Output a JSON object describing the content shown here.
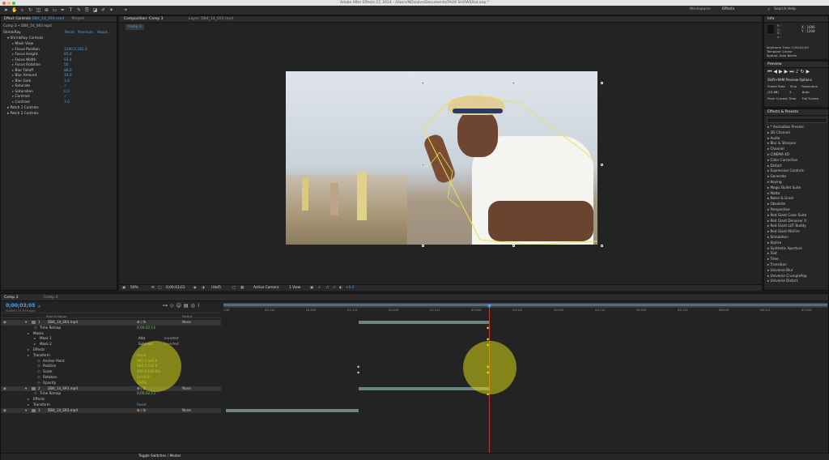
{
  "app": {
    "title": "Adobe After Effects CC 2014 - /Users/NDisalvo/Documents/FAUX SHOWS/tut.aep *",
    "workspace_label": "Workspace:",
    "workspace_value": "Effects",
    "search_placeholder": "Search Help"
  },
  "effect_controls": {
    "tab_label": "Effect Controls",
    "tab_file": "DB4_14_S93.mp4",
    "project_tab": "Project",
    "breadcrumb": "Comp 3 • DB4_14_S93.mp4",
    "effect_name": "ShrinkRay",
    "links": [
      "Reset",
      "Premium",
      "About..."
    ],
    "group": "ShrinkRay Controls",
    "params": [
      {
        "name": "Mask View",
        "value": ""
      },
      {
        "name": "Focus Position",
        "value": "1200.0,282.0"
      },
      {
        "name": "Focus Height",
        "value": "95.0"
      },
      {
        "name": "Focus Width",
        "value": "93.4"
      },
      {
        "name": "Focus Rotation",
        "value": "50"
      },
      {
        "name": "Blur Falloff",
        "value": "88.0"
      },
      {
        "name": "Blur Amount",
        "value": "14.0"
      },
      {
        "name": "Blur Gain",
        "value": "1.0"
      },
      {
        "name": "Saturate",
        "value": "✓"
      },
      {
        "name": "Saturation",
        "value": "0.0"
      },
      {
        "name": "Contrast",
        "value": "✓"
      },
      {
        "name": "Contrast",
        "value": "3.0"
      }
    ],
    "extra": [
      "Patch 1 Controls",
      "Patch 2 Controls"
    ]
  },
  "composition": {
    "tab_label": "Composition: Comp 3",
    "layer_tab": "Layer: DB4_14_S93.mp4",
    "sub_tab": "Comp 3",
    "zoom": "50%",
    "timecode": "0;00;03;01",
    "resolution": "(Half)",
    "camera": "Active Camera",
    "view": "1 View",
    "exposure": "+0.0"
  },
  "info": {
    "tab": "Info",
    "r": "R :",
    "g": "G :",
    "b": "B :",
    "a": "A :",
    "x": "X : 1696",
    "y": "Y : 1208",
    "keyframe_time": "Keyframe Time: 0;00;02;00",
    "temporal": "Temporal: Linear",
    "spatial": "Spatial: Auto Bezier"
  },
  "preview": {
    "tab": "Preview",
    "options": "Shift+RAM Preview Options",
    "frame_rate_label": "Frame Rate",
    "skip_label": "Skip",
    "resolution_label": "Resolution",
    "frame_rate": "(23.98)",
    "skip": "2",
    "resolution": "Auto",
    "from_current": "From Current Time",
    "full_screen": "Full Screen"
  },
  "effects_presets": {
    "tab": "Effects & Presets",
    "items": [
      "* Animation Presets",
      "3D Channel",
      "Audio",
      "Blur & Sharpen",
      "Channel",
      "CINEMA 4D",
      "Color Correction",
      "Distort",
      "Expression Controls",
      "Generate",
      "Keying",
      "Magic Bullet Suite",
      "Matte",
      "Noise & Grain",
      "Obsolete",
      "Perspective",
      "Red Giant Color Suite",
      "Red Giant Denoiser II",
      "Red Giant LUT Buddy",
      "Red Giant MisFire",
      "Simulation",
      "Stylize",
      "Synthetic Aperture",
      "Text",
      "Time",
      "Transition",
      "Universe Blur",
      "Universe CrumplePop",
      "Universe Distort"
    ]
  },
  "timeline": {
    "tab_active": "Comp 3",
    "tab_other": "Comp 4",
    "timecode": "0;00;03;05",
    "fps_info": "00095 (23.976 fps)",
    "col_source": "Source Name",
    "col_parent": "Parent",
    "ruler": [
      ";00f",
      "00:12f",
      "01:00f",
      "01:12f",
      "02:00f",
      "02:12f",
      "03:00f",
      "03:12f",
      "04:00f",
      "04:12f",
      "05:00f",
      "05:12f",
      "06:00f",
      "06:12f",
      "07:00f"
    ],
    "rows": [
      {
        "kind": "layer",
        "num": "1",
        "name": "DB4_14_S93.mp4",
        "parent": "None"
      },
      {
        "kind": "prop",
        "name": "Time Remap",
        "value": "0;00;02;14"
      },
      {
        "kind": "group",
        "name": "Masks"
      },
      {
        "kind": "mask",
        "name": "Mask 1",
        "mode": "Add",
        "inverted": "Inverted"
      },
      {
        "kind": "mask",
        "name": "Mask 2",
        "mode": "Subtract",
        "inverted": "Inverted"
      },
      {
        "kind": "group",
        "name": "Effects"
      },
      {
        "kind": "group",
        "name": "Transform",
        "value": "Reset"
      },
      {
        "kind": "prop",
        "name": "Anchor Point",
        "value": "960.0,540.0"
      },
      {
        "kind": "prop",
        "name": "Position",
        "value": "808.0,516.0"
      },
      {
        "kind": "prop",
        "name": "Scale",
        "value": "100.0,100.0%"
      },
      {
        "kind": "prop",
        "name": "Rotation",
        "value": "0x+0.0°"
      },
      {
        "kind": "prop",
        "name": "Opacity",
        "value": "100%"
      },
      {
        "kind": "layer",
        "num": "2",
        "name": "DB4_14_S93.mp4",
        "parent": "None"
      },
      {
        "kind": "prop",
        "name": "Time Remap",
        "value": "0;00;02;13"
      },
      {
        "kind": "group",
        "name": "Effects"
      },
      {
        "kind": "group",
        "name": "Transform",
        "value": "Reset"
      },
      {
        "kind": "layer",
        "num": "3",
        "name": "DB4_14_S93.mp4",
        "parent": "None"
      }
    ],
    "footer": "Toggle Switches / Modes"
  },
  "colors": {
    "accent_blue": "#4aa3e8",
    "keyframe_yellow": "#e6e61e",
    "playhead": "#c0392b"
  }
}
